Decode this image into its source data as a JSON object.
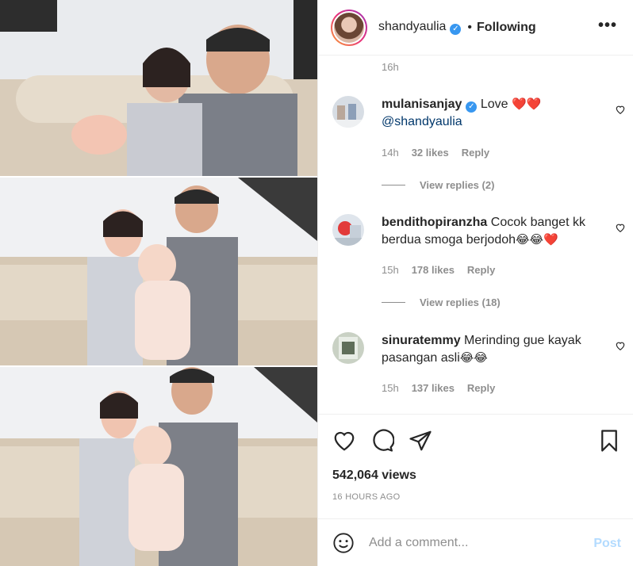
{
  "header": {
    "username": "shandyaulia",
    "verified_mark": "✓",
    "separator": "•",
    "follow_status": "Following",
    "more_glyph": "•••"
  },
  "post_time": "16h",
  "comments": [
    {
      "username": "mulanisanjay",
      "verified_mark": "✓",
      "text": "Love",
      "emoji": "❤️❤️",
      "mention": "@shandyaulia",
      "time": "14h",
      "likes": "32 likes",
      "reply": "Reply",
      "view_replies": "View replies (2)"
    },
    {
      "username": "bendithopiranzha",
      "text": "Cocok banget kk berdua smoga berjodoh",
      "emoji": "😂😂❤️",
      "time": "15h",
      "likes": "178 likes",
      "reply": "Reply",
      "view_replies": "View replies (18)"
    },
    {
      "username": "sinuratemmy",
      "text": "Merinding gue kayak pasangan asli",
      "emoji": "😂😂",
      "time": "15h",
      "likes": "137 likes",
      "reply": "Reply"
    }
  ],
  "actions": {
    "like_icon": "heart-outline-icon",
    "comment_icon": "comment-bubble-icon",
    "share_icon": "paper-plane-icon",
    "save_icon": "bookmark-icon"
  },
  "views": "542,064 views",
  "posted_ago": "16 HOURS AGO",
  "comment_box": {
    "placeholder": "Add a comment...",
    "post_label": "Post"
  },
  "colors": {
    "link": "#00376b",
    "verified": "#3897f0",
    "muted": "#8e8e8e",
    "post_disabled": "#b3dbff"
  }
}
